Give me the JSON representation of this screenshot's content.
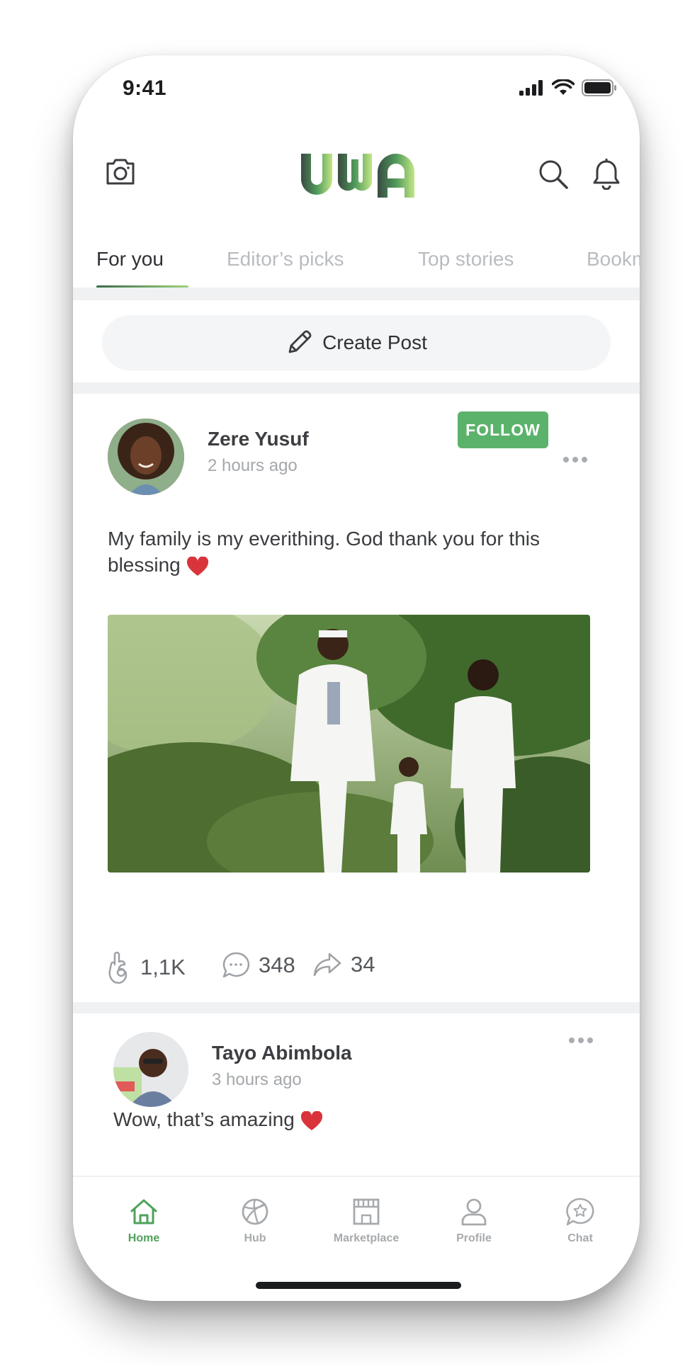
{
  "status_bar": {
    "time": "9:41"
  },
  "header": {
    "logo_text": "UWA"
  },
  "tabs": [
    {
      "label": "For you",
      "active": true
    },
    {
      "label": "Editor’s picks",
      "active": false
    },
    {
      "label": "Top stories",
      "active": false
    },
    {
      "label": "Bookm",
      "active": false
    }
  ],
  "create_post": {
    "label": "Create Post",
    "icon": "pencil-icon"
  },
  "posts": [
    {
      "author": "Zere Yusuf",
      "time": "2 hours ago",
      "follow_label": "FOLLOW",
      "text": "My family is my everithing. God thank you for this blessing",
      "stats": {
        "likes": "1,1K",
        "comments": "348",
        "shares": "34"
      }
    },
    {
      "author": "Tayo Abimbola",
      "time": "3 hours ago",
      "text": "Wow, that’s amazing"
    }
  ],
  "nav": {
    "items": [
      {
        "label": "Home",
        "icon": "home-icon",
        "active": true
      },
      {
        "label": "Hub",
        "icon": "ball-icon",
        "active": false
      },
      {
        "label": "Marketplace",
        "icon": "store-icon",
        "active": false
      },
      {
        "label": "Profile",
        "icon": "person-icon",
        "active": false
      },
      {
        "label": "Chat",
        "icon": "chat-star-icon",
        "active": false
      }
    ]
  },
  "colors": {
    "accent": "#5bb36b",
    "heart": "#d9343c",
    "logo_dark": "#3a4a41",
    "logo_light": "#b5e07f"
  }
}
